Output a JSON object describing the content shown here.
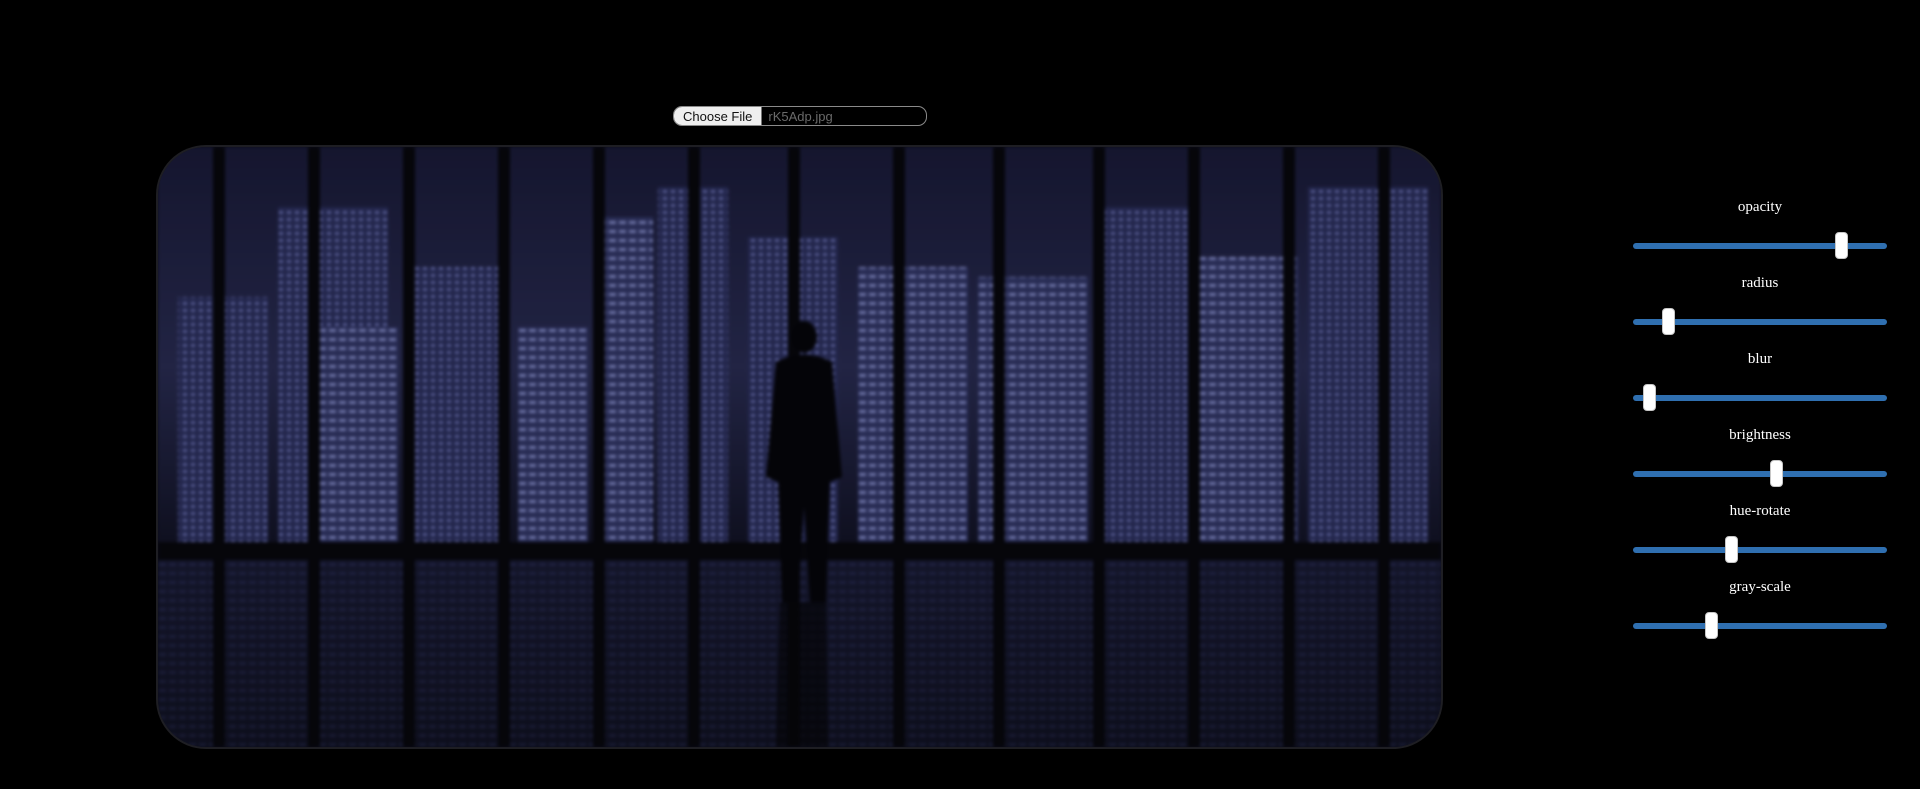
{
  "file_input": {
    "button_label": "Choose File",
    "file_name": "rK5Adp.jpg"
  },
  "controls": [
    {
      "label": "opacity",
      "value_fraction": 0.84
    },
    {
      "label": "radius",
      "value_fraction": 0.12
    },
    {
      "label": "blur",
      "value_fraction": 0.04
    },
    {
      "label": "brightness",
      "value_fraction": 0.57
    },
    {
      "label": "hue-rotate",
      "value_fraction": 0.38
    },
    {
      "label": "gray-scale",
      "value_fraction": 0.3
    }
  ],
  "colors": {
    "background": "#000000",
    "slider_track": "#2f6fb0",
    "slider_thumb": "#ffffff"
  }
}
